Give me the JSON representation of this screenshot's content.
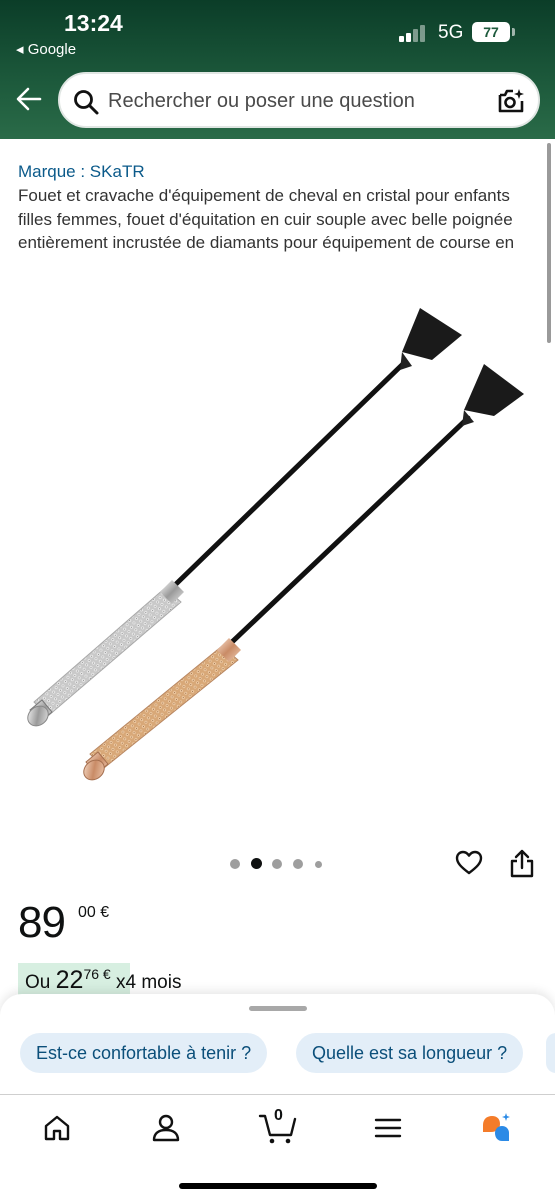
{
  "status_bar": {
    "time": "13:24",
    "back_app": "◂ Google",
    "network": "5G",
    "battery": "77"
  },
  "search": {
    "placeholder": "Rechercher ou poser une question"
  },
  "product": {
    "brand": "Marque : SKaTR",
    "title": "Fouet et cravache d'équipement de cheval en cristal pour enfants filles femmes, fouet d'équitation en cuir souple avec belle poignée entièrement incrustée de diamants pour équipement de course en",
    "price_int": "89",
    "price_frac": "00 €",
    "installment_prefix": "Ou",
    "installment_int": "22",
    "installment_frac": "76 €",
    "installment_suffix": "x4 mois",
    "image_count": 5,
    "image_active_index": 1
  },
  "suggestions": [
    {
      "label": "Est-ce confortable à tenir ?"
    },
    {
      "label": "Quelle est sa longueur ?"
    }
  ],
  "tabbar": {
    "cart_count": "0",
    "items": [
      {
        "icon": "home-icon"
      },
      {
        "icon": "account-icon"
      },
      {
        "icon": "cart-icon"
      },
      {
        "icon": "menu-icon"
      },
      {
        "icon": "rufus-assistant-icon"
      }
    ]
  },
  "colors": {
    "header_dark": "#0b3d28",
    "header_light": "#2a6b48",
    "link": "#0b5a8a",
    "installment_bg": "#d7efe1",
    "chip_bg": "#e3eef8"
  }
}
